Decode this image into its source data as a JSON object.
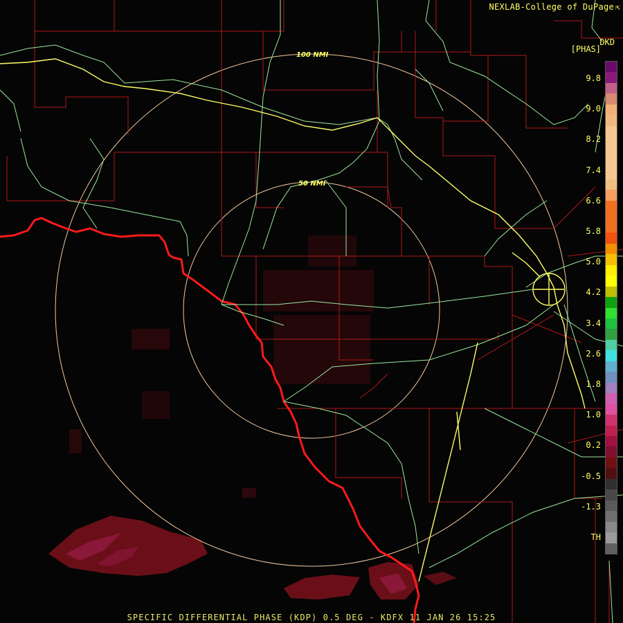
{
  "credit": "NEXLAB-College of DuPage",
  "product_code": "DKD",
  "unit_label": "[PHAS]",
  "ring_labels": {
    "outer": "100 NMI",
    "inner": "50 NMI"
  },
  "footer": "SPECIFIC DIFFERENTIAL PHASE (KDP) 0.5 DEG - KDFX 11 JAN 26 15:25",
  "legend": {
    "ticks": [
      "9.8",
      "9.0",
      "8.2",
      "7.4",
      "6.6",
      "5.8",
      "5.0",
      "4.2",
      "3.4",
      "2.6",
      "1.8",
      "1.0",
      "0.2",
      "-0.5",
      "-1.3",
      "TH"
    ],
    "colors": [
      "#6a0a6a",
      "#8a1a7a",
      "#c0608a",
      "#d88a70",
      "#f2b078",
      "#f0b880",
      "#f6c890",
      "#f6c890",
      "#f6c890",
      "#f6c890",
      "#f6c890",
      "#f0c080",
      "#f4a060",
      "#f07020",
      "#f07020",
      "#f07020",
      "#f05010",
      "#f09000",
      "#f4c000",
      "#ffee00",
      "#ffff00",
      "#c0c000",
      "#10a010",
      "#30e030",
      "#20c040",
      "#30a040",
      "#50d0a0",
      "#40e0e0",
      "#60b0d0",
      "#7090c0",
      "#a080c0",
      "#d060b0",
      "#e050a0",
      "#d03070",
      "#c02050",
      "#a01040",
      "#801030",
      "#701010",
      "#501010",
      "#303030",
      "#484848",
      "#5a5a5a",
      "#707070",
      "#888888",
      "#9a9a9a",
      "#606060"
    ]
  },
  "colors": {
    "boundary": "#b01818",
    "border": "#ff1a1a",
    "highway": "#9ee89e",
    "interstate": "#ffff66",
    "ring": "#f2c9a0"
  }
}
